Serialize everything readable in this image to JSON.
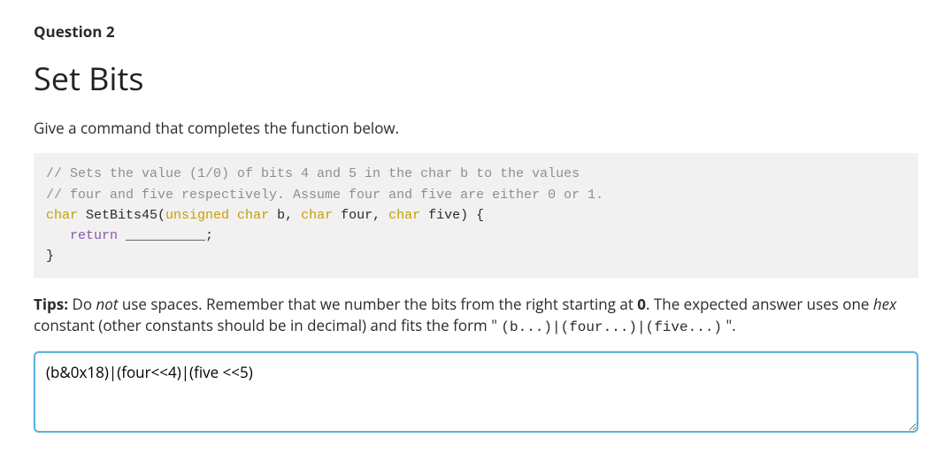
{
  "question": {
    "label": "Question 2",
    "title": "Set Bits",
    "prompt": "Give a command that completes the function below."
  },
  "code": {
    "line1_comment": "// Sets the value (1/0) of bits 4 and 5 in the char b to the values",
    "line2_comment": "// four and five respectively. Assume four and five are either 0 or 1.",
    "sig_type1": "char",
    "sig_fn": " SetBits45(",
    "sig_p1t": "unsigned char",
    "sig_p1n": " b, ",
    "sig_p2t": "char",
    "sig_p2n": " four, ",
    "sig_p3t": "char",
    "sig_p3n": " five) {",
    "ret_kw": "return",
    "ret_rest": " __________;",
    "close": "}"
  },
  "tips": {
    "label": "Tips:",
    "t1": " Do ",
    "not": "not",
    "t2": " use spaces. Remember that we number the bits from the right starting at ",
    "zero": "0",
    "t3": ". The expected answer uses one ",
    "hex": "hex",
    "t4": " constant (other constants should be in decimal) and fits the form \" ",
    "form": "(b...)|(four...)|(five...)",
    "t5": " \"."
  },
  "answer": {
    "value": "(b&0x18)|(four<<4)|(five <<5)"
  }
}
